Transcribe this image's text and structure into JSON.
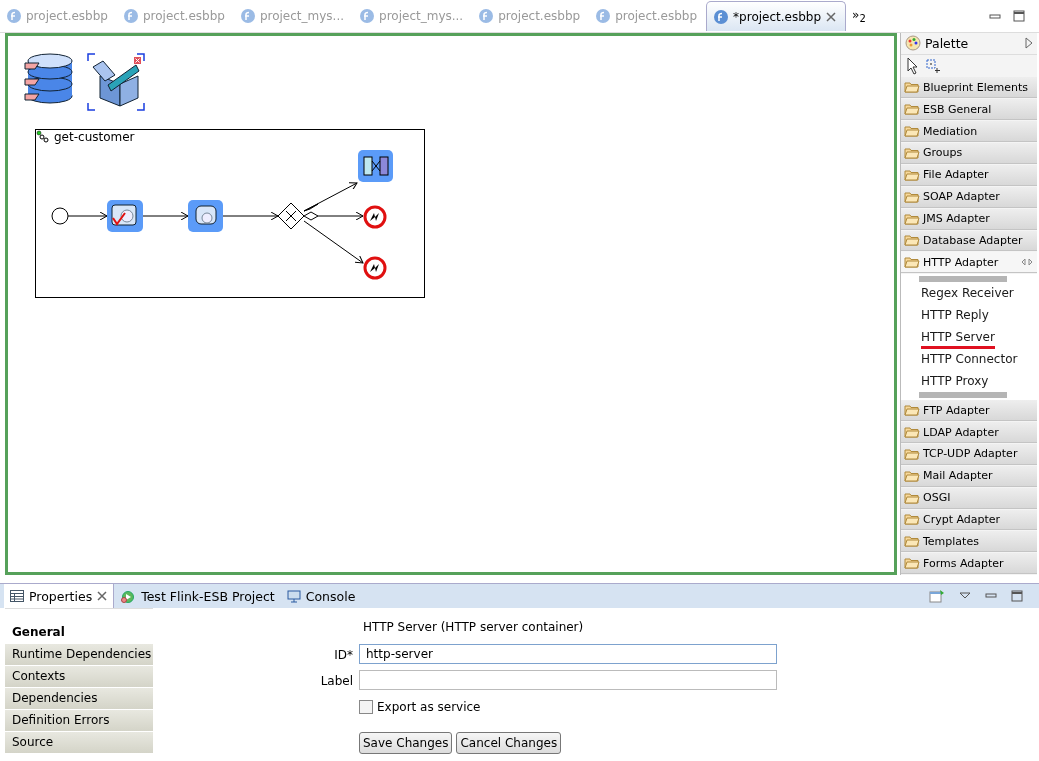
{
  "editor_tabs": [
    {
      "label": "project.esbbp",
      "selected": false
    },
    {
      "label": "project.esbbp",
      "selected": false
    },
    {
      "label": "project_mys...",
      "selected": false
    },
    {
      "label": "project_mys...",
      "selected": false
    },
    {
      "label": "project.esbbp",
      "selected": false
    },
    {
      "label": "project.esbbp",
      "selected": false
    },
    {
      "label": "*project.esbbp",
      "selected": true
    }
  ],
  "tab_overflow": "»$_{2}$",
  "diagram": {
    "group_title": "get-customer"
  },
  "palette": {
    "title": "Palette",
    "drawers": [
      {
        "label": "Blueprint Elements",
        "expanded": false
      },
      {
        "label": "ESB General",
        "expanded": false
      },
      {
        "label": "Mediation",
        "expanded": false
      },
      {
        "label": "Groups",
        "expanded": false
      },
      {
        "label": "File Adapter",
        "expanded": false
      },
      {
        "label": "SOAP Adapter",
        "expanded": false
      },
      {
        "label": "JMS Adapter",
        "expanded": false
      },
      {
        "label": "Database Adapter",
        "expanded": false
      },
      {
        "label": "HTTP Adapter",
        "expanded": true,
        "children": [
          {
            "label": "Regex Receiver",
            "selected": false
          },
          {
            "label": "HTTP Reply",
            "selected": false
          },
          {
            "label": "HTTP Server",
            "selected": true
          },
          {
            "label": "HTTP Connector",
            "selected": false
          },
          {
            "label": "HTTP Proxy",
            "selected": false
          }
        ]
      },
      {
        "label": "FTP Adapter",
        "expanded": false
      },
      {
        "label": "LDAP Adapter",
        "expanded": false
      },
      {
        "label": "TCP-UDP Adapter",
        "expanded": false
      },
      {
        "label": "Mail Adapter",
        "expanded": false
      },
      {
        "label": "OSGI",
        "expanded": false
      },
      {
        "label": "Crypt Adapter",
        "expanded": false
      },
      {
        "label": "Templates",
        "expanded": false
      },
      {
        "label": "Forms Adapter",
        "expanded": false
      }
    ]
  },
  "bottom_tabs": [
    {
      "label": "Properties",
      "kind": "properties",
      "selected": true
    },
    {
      "label": "Test Flink-ESB Project",
      "kind": "test",
      "selected": false
    },
    {
      "label": "Console",
      "kind": "console",
      "selected": false
    }
  ],
  "properties": {
    "side_tabs": [
      {
        "label": "General",
        "selected": true
      },
      {
        "label": "Runtime Dependencies",
        "selected": false
      },
      {
        "label": "Contexts",
        "selected": false
      },
      {
        "label": "Dependencies",
        "selected": false
      },
      {
        "label": "Definition Errors",
        "selected": false
      },
      {
        "label": "Source",
        "selected": false
      }
    ],
    "title": "HTTP Server (HTTP server container)",
    "fields": [
      {
        "label": "ID*",
        "value": "http-server"
      },
      {
        "label": "Label"
      }
    ],
    "checkbox": {
      "label": "Export as service",
      "checked": false
    },
    "buttons": [
      "Save Changes",
      "Cancel Changes"
    ]
  }
}
